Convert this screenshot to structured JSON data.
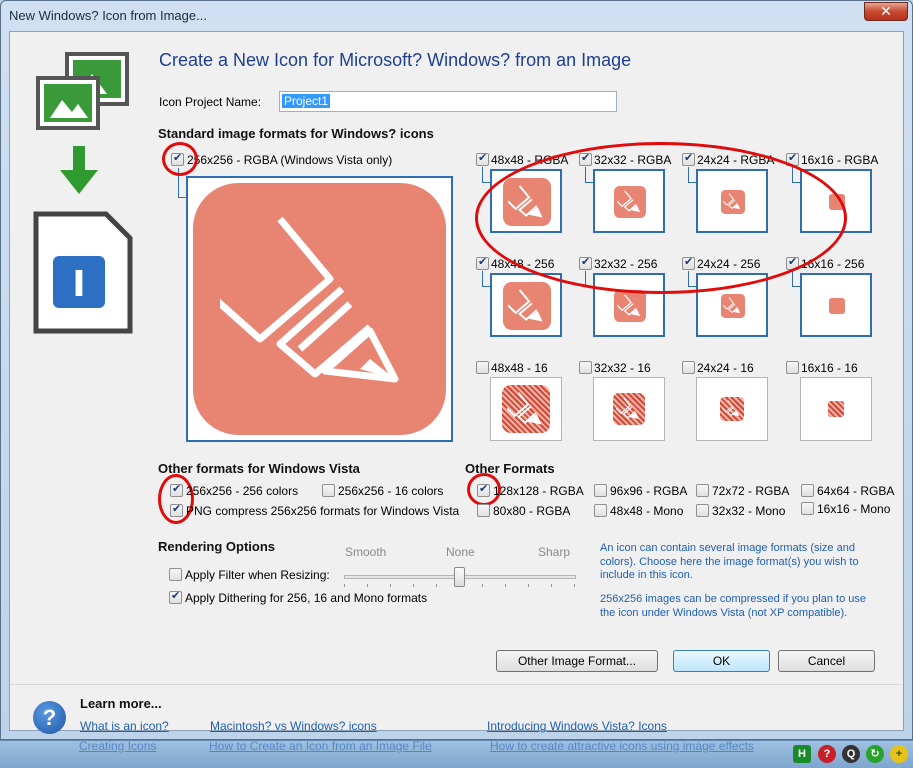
{
  "window": {
    "title": "New Windows? Icon from Image...",
    "close_label": "✕"
  },
  "heading": "Create a New Icon for Microsoft? Windows? from an Image",
  "project_name": {
    "label": "Icon Project Name:",
    "value": "Project1"
  },
  "standard_section": {
    "title": "Standard image formats for Windows? icons"
  },
  "main_format": {
    "label": "256x256 - RGBA (Windows Vista only)",
    "checked": true
  },
  "formats": [
    {
      "label": "48x48 - RGBA",
      "checked": true
    },
    {
      "label": "32x32 - RGBA",
      "checked": true
    },
    {
      "label": "24x24 - RGBA",
      "checked": true
    },
    {
      "label": "16x16 - RGBA",
      "checked": true
    },
    {
      "label": "48x48 - 256",
      "checked": true
    },
    {
      "label": "32x32 - 256",
      "checked": true
    },
    {
      "label": "24x24 - 256",
      "checked": true
    },
    {
      "label": "16x16 - 256",
      "checked": true
    },
    {
      "label": "48x48 - 16",
      "checked": false
    },
    {
      "label": "32x32 - 16",
      "checked": false
    },
    {
      "label": "24x24 - 16",
      "checked": false
    },
    {
      "label": "16x16 - 16",
      "checked": false
    }
  ],
  "vista_section": {
    "title": "Other formats for Windows Vista",
    "options": [
      {
        "label": "256x256 - 256 colors",
        "checked": true
      },
      {
        "label": "256x256 - 16 colors",
        "checked": false
      },
      {
        "label": "PNG compress 256x256 formats for Windows Vista",
        "checked": true
      }
    ]
  },
  "other_section": {
    "title": "Other Formats",
    "options": [
      {
        "label": "128x128 - RGBA",
        "checked": true
      },
      {
        "label": "96x96 - RGBA",
        "checked": false
      },
      {
        "label": "72x72 - RGBA",
        "checked": false
      },
      {
        "label": "64x64 - RGBA",
        "checked": false
      },
      {
        "label": "80x80 - RGBA",
        "checked": false
      },
      {
        "label": "48x48 - Mono",
        "checked": false
      },
      {
        "label": "32x32 - Mono",
        "checked": false
      },
      {
        "label": "16x16 - Mono",
        "checked": false
      }
    ]
  },
  "rendering": {
    "title": "Rendering Options",
    "apply_filter": {
      "label": "Apply Filter when Resizing:",
      "checked": false
    },
    "apply_dithering": {
      "label": "Apply Dithering for 256, 16 and Mono formats",
      "checked": true
    },
    "slider_labels": [
      "Smooth",
      "None",
      "Sharp"
    ],
    "slider_value": "None"
  },
  "info_text_1": "An icon can contain several image formats (size and colors). Choose here the image format(s) you wish to include in this icon.",
  "info_text_2": "256x256 images can be compressed if you plan to use the icon under Windows Vista (not XP compatible).",
  "buttons": {
    "other_format": "Other Image Format...",
    "ok": "OK",
    "cancel": "Cancel"
  },
  "learn_more": {
    "title": "Learn more...",
    "links": [
      "What is an icon?",
      "Macintosh? vs Windows? icons",
      "Introducing Windows Vista? Icons",
      "Creating Icons",
      "How to Create an Icon from an Image File",
      "How to create attractive icons using image effects"
    ]
  },
  "help_icon_label": "?",
  "colors": {
    "accent": "#2f6db5",
    "icon_fill": "#e88472",
    "annotation": "#e10b0b",
    "heading": "#1e3f8f"
  }
}
